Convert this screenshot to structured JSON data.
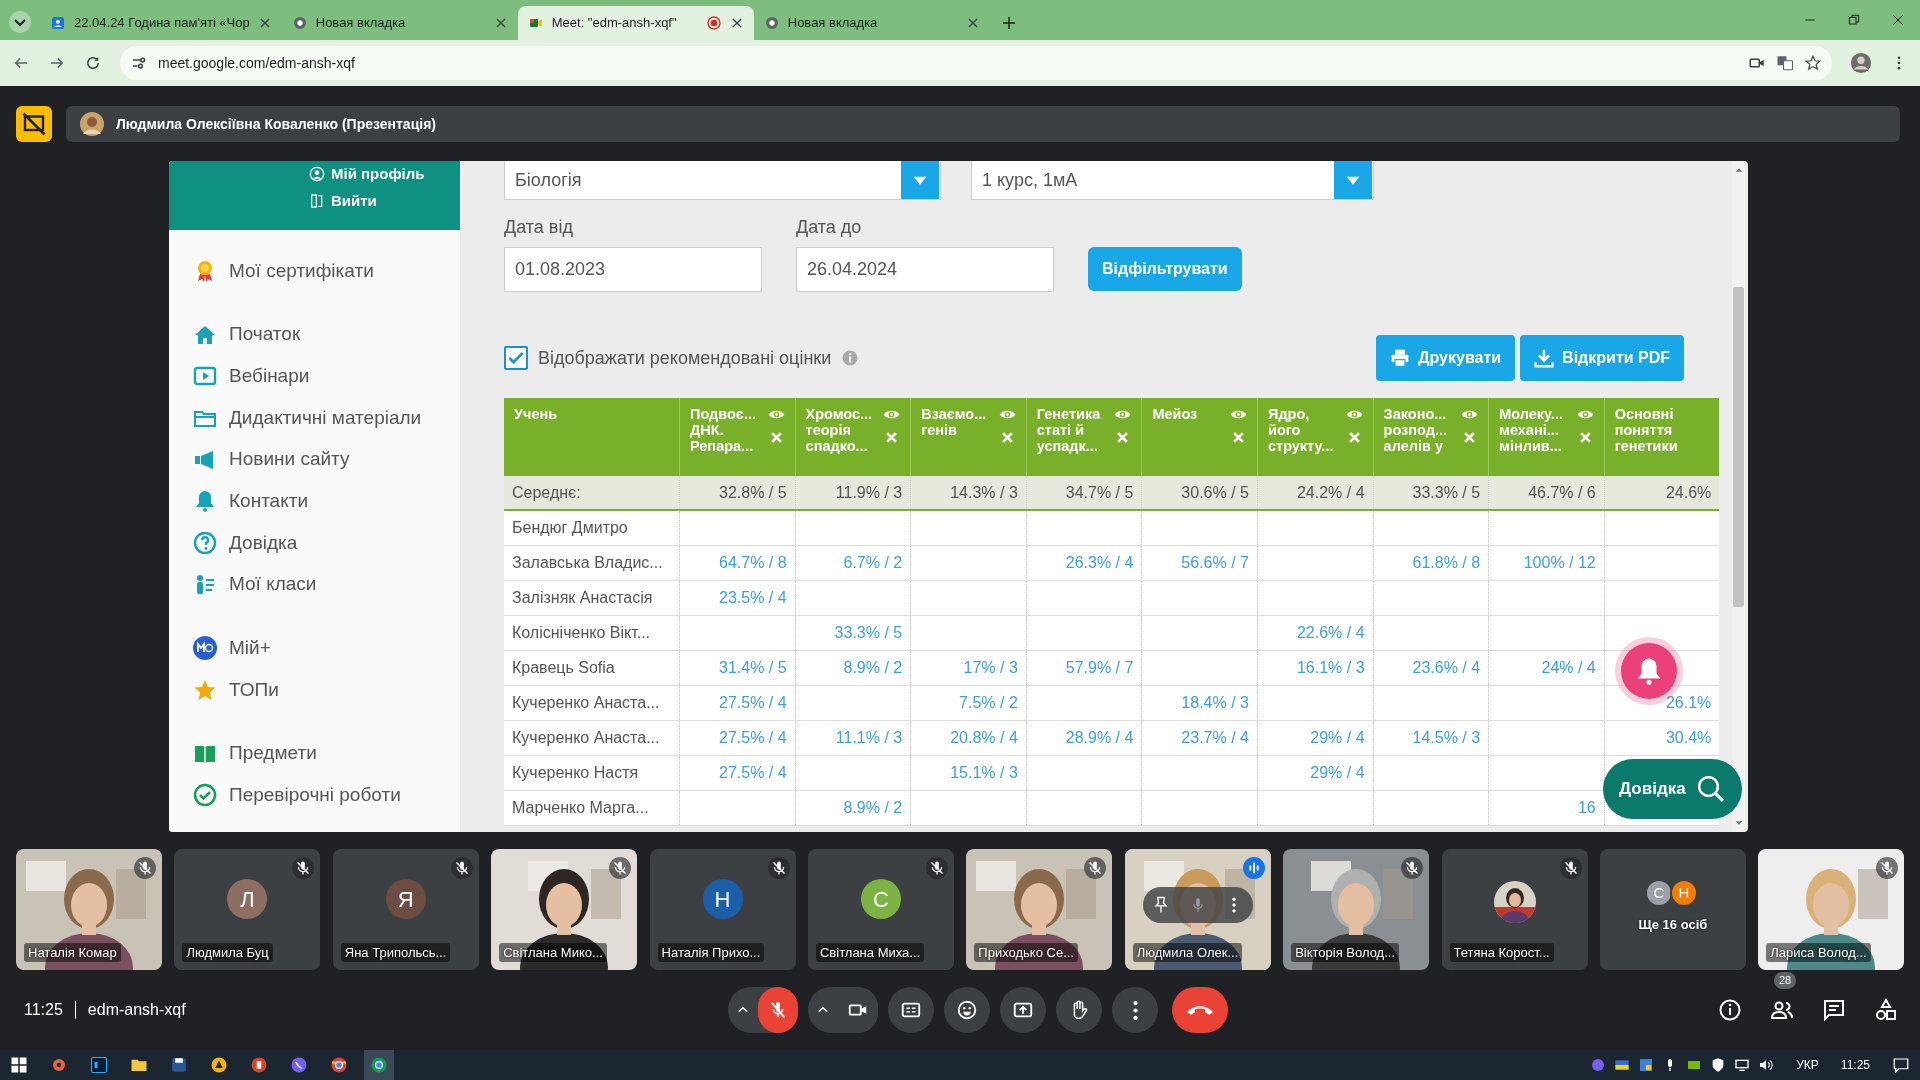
{
  "browser": {
    "tabs": [
      {
        "kind": "site",
        "title": "22.04.24 Година пам'яті «Чор",
        "selected": false,
        "recording": false
      },
      {
        "kind": "newtab",
        "title": "Новая вкладка",
        "selected": false,
        "recording": false
      },
      {
        "kind": "meet",
        "title": "Meet: \"edm-ansh-xqf\"",
        "selected": true,
        "recording": true
      },
      {
        "kind": "newtab",
        "title": "Новая вкладка",
        "selected": false,
        "recording": false
      }
    ],
    "url": "meet.google.com/edm-ansh-xqf"
  },
  "presenter_bar": {
    "title": "Людмила Олексіївна Коваленко (Презентація)"
  },
  "shared_screen": {
    "sidebar": {
      "profile_links": [
        "Мій профіль",
        "Вийти"
      ],
      "sections": [
        [
          "Мої сертифікати"
        ],
        [
          "Початок",
          "Вебінари",
          "Дидактичні матеріали",
          "Новини сайту",
          "Контакти",
          "Довідка",
          "Мої класи"
        ],
        [
          "Мій+",
          "ТОПи"
        ],
        [
          "Предмети",
          "Перевірочні роботи"
        ]
      ]
    },
    "filters": {
      "subject": "Біологія",
      "group": "1 курс, 1мА",
      "date_from_label": "Дата від",
      "date_from": "01.08.2023",
      "date_to_label": "Дата до",
      "date_to": "26.04.2024",
      "filter_button": "Відфільтрувати"
    },
    "show_recommended": {
      "label": "Відображати рекомендовані оцінки",
      "checked": true
    },
    "actions": [
      "Друкувати",
      "Відкрити PDF"
    ],
    "table": {
      "columns": [
        {
          "title": "Учень",
          "controls": false
        },
        {
          "title": "Подвоє...\nДНК.\nРепара...",
          "controls": true
        },
        {
          "title": "Хромос...\nтеорія\nспадко...",
          "controls": true
        },
        {
          "title": "Взаємо...\nгенів",
          "controls": true
        },
        {
          "title": "Генетика\nстаті й\nуспадк...",
          "controls": true
        },
        {
          "title": "Мейоз",
          "controls": true
        },
        {
          "title": "Ядро,\nйого\nструкту...",
          "controls": true
        },
        {
          "title": "Законо...\nрозпод...\nалелів у",
          "controls": true
        },
        {
          "title": "Молеку...\nмехані...\nмінлив...",
          "controls": true
        },
        {
          "title": "Основні\nпоняття\nгенетики",
          "controls": false
        }
      ],
      "average": [
        "Середнє:",
        "32.8% / 5",
        "11.9% / 3",
        "14.3% / 3",
        "34.7% / 5",
        "30.6% / 5",
        "24.2% / 4",
        "33.3% / 5",
        "46.7% / 6",
        "24.6%"
      ],
      "rows": [
        [
          "Бендюг Дмитро",
          null,
          null,
          null,
          null,
          null,
          null,
          null,
          null,
          null
        ],
        [
          "Залавська Владис...",
          "64.7% / 8",
          "6.7% / 2",
          null,
          "26.3% / 4",
          "56.6% / 7",
          null,
          "61.8% / 8",
          "100% / 12",
          null
        ],
        [
          "Залізняк Анастасія",
          "23.5% / 4",
          null,
          null,
          null,
          null,
          null,
          null,
          null,
          null
        ],
        [
          "Колісніченко Вікт...",
          null,
          "33.3% / 5",
          null,
          null,
          null,
          "22.6% / 4",
          null,
          null,
          null
        ],
        [
          "Кравець Sofia",
          "31.4% / 5",
          "8.9% / 2",
          "17% / 3",
          "57.9% / 7",
          null,
          "16.1% / 3",
          "23.6% / 4",
          "24% / 4",
          null
        ],
        [
          "Кучеренко Анаста...",
          "27.5% / 4",
          null,
          "7.5% / 2",
          null,
          "18.4% / 3",
          null,
          null,
          null,
          "26.1%"
        ],
        [
          "Кучеренко Анаста...",
          "27.5% / 4",
          "11.1% / 3",
          "20.8% / 4",
          "28.9% / 4",
          "23.7% / 4",
          "29% / 4",
          "14.5% / 3",
          null,
          "30.4%"
        ],
        [
          "Кучеренко Настя",
          "27.5% / 4",
          null,
          "15.1% / 3",
          null,
          null,
          "29% / 4",
          null,
          null,
          null
        ],
        [
          "Марченко Марга...",
          null,
          "8.9% / 2",
          null,
          null,
          null,
          null,
          null,
          "16",
          null
        ]
      ]
    },
    "help_button": "Довідка"
  },
  "participants": [
    {
      "kind": "video",
      "name": "Наталія Комар",
      "muted": true,
      "speaking": false
    },
    {
      "kind": "letter",
      "letter": "Л",
      "color": "#8d6e63",
      "name": "Людмила Буц",
      "muted": true,
      "speaking": false
    },
    {
      "kind": "letter",
      "letter": "Я",
      "color": "#6d4c41",
      "name": "Яна Трипольсь...",
      "muted": true,
      "speaking": false
    },
    {
      "kind": "video",
      "name": "Світлана Мико...",
      "muted": true,
      "speaking": false
    },
    {
      "kind": "letter",
      "letter": "Н",
      "color": "#1a5fa8",
      "name": "Наталія Прихо...",
      "muted": true,
      "speaking": false
    },
    {
      "kind": "letter",
      "letter": "С",
      "color": "#7cb342",
      "name": "Світлана Миха...",
      "muted": true,
      "speaking": false
    },
    {
      "kind": "video",
      "name": "Приходько Се...",
      "muted": true,
      "speaking": false
    },
    {
      "kind": "video",
      "name": "Людмила Олек...",
      "muted": false,
      "speaking": true
    },
    {
      "kind": "video",
      "name": "Вікторія Волод...",
      "muted": true,
      "speaking": false
    },
    {
      "name": "Тетяна Корост...",
      "muted": true,
      "speaking": false
    },
    {
      "kind": "more",
      "name": "Ще 16 осіб",
      "avatars": [
        {
          "letter": "С",
          "color": "#9aa0a6"
        },
        {
          "letter": "Н",
          "color": "#f57c00"
        }
      ]
    },
    {
      "kind": "video",
      "name": "Лариса Волод...",
      "muted": true,
      "speaking": false
    }
  ],
  "meeting_bar": {
    "time": "11:25",
    "code": "edm-ansh-xqf",
    "mic_on": false,
    "people_count": "28"
  },
  "taskbar": {
    "language": "УКР",
    "time": "11:25"
  }
}
